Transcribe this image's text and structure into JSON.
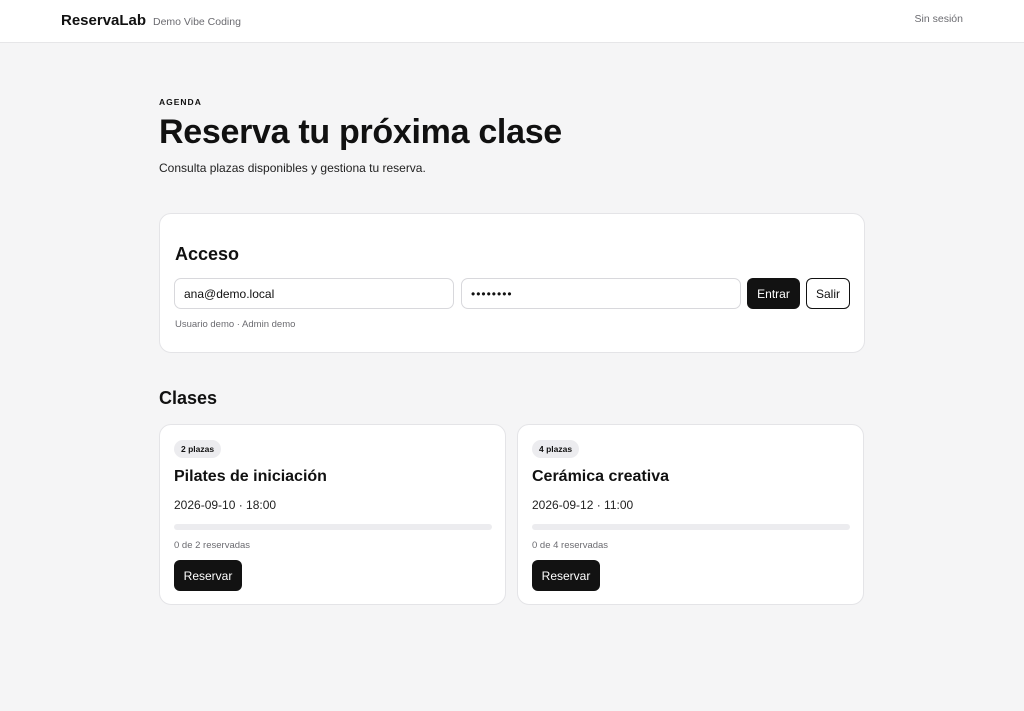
{
  "header": {
    "brand": "ReservaLab",
    "subtitle": "Demo Vibe Coding",
    "session_status": "Sin sesión"
  },
  "hero": {
    "eyebrow": "AGENDA",
    "title": "Reserva tu próxima clase",
    "subtitle": "Consulta plazas disponibles y gestiona tu reserva."
  },
  "access": {
    "title": "Acceso",
    "email_value": "ana@demo.local",
    "password_value": "••••••••",
    "login_label": "Entrar",
    "logout_label": "Salir",
    "hint": "Usuario demo · Admin demo"
  },
  "classes": {
    "title": "Clases",
    "items": [
      {
        "badge": "2 plazas",
        "name": "Pilates de iniciación",
        "datetime": "2026-09-10 · 18:00",
        "reserved_count": 0,
        "capacity": 2,
        "reserved_text": "0 de 2 reservadas",
        "button_label": "Reservar"
      },
      {
        "badge": "4 plazas",
        "name": "Cerámica creativa",
        "datetime": "2026-09-12 · 11:00",
        "reserved_count": 0,
        "capacity": 4,
        "reserved_text": "0 de 4 reservadas",
        "button_label": "Reservar"
      }
    ]
  },
  "colors": {
    "background": "#f5f5f6",
    "card": "#ffffff",
    "primary": "#121212",
    "muted_text": "#6b6b70",
    "track": "#ececef"
  }
}
